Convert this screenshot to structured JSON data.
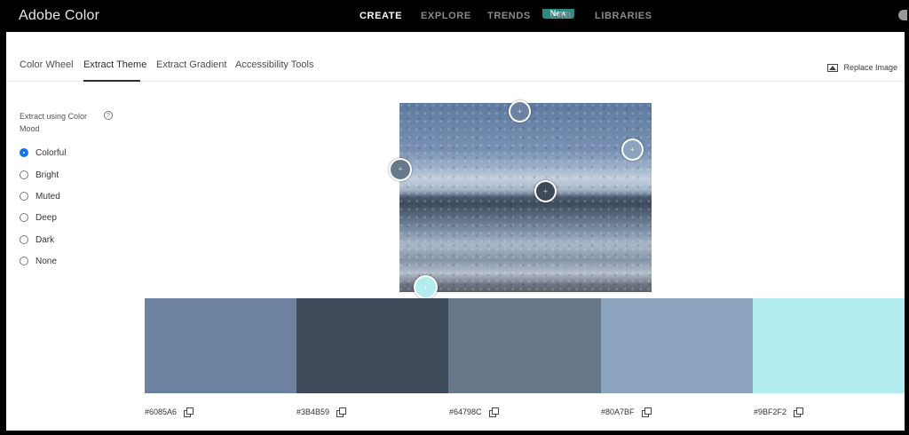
{
  "app": {
    "title": "Adobe Color"
  },
  "nav": {
    "items": [
      {
        "label": "CREATE"
      },
      {
        "label": "EXPLORE"
      },
      {
        "label": "TRENDS"
      },
      {
        "label": "LAB"
      },
      {
        "label": "LIBRARIES"
      }
    ],
    "active": "CREATE",
    "badge": "New"
  },
  "tabs": {
    "items": [
      {
        "label": "Color Wheel"
      },
      {
        "label": "Extract Theme"
      },
      {
        "label": "Extract Gradient"
      },
      {
        "label": "Accessibility Tools"
      }
    ],
    "active": "Extract Theme",
    "replace_label": "Replace Image"
  },
  "sidebar": {
    "mood_label": "Extract using Color Mood",
    "help": "?",
    "options": [
      {
        "label": "Colorful",
        "checked": true
      },
      {
        "label": "Bright",
        "checked": false
      },
      {
        "label": "Muted",
        "checked": false
      },
      {
        "label": "Deep",
        "checked": false
      },
      {
        "label": "Dark",
        "checked": false
      },
      {
        "label": "None",
        "checked": false
      }
    ]
  },
  "swatches": [
    {
      "hex": "#6085A6",
      "color": "#6d82a0"
    },
    {
      "hex": "#3B4B59",
      "color": "#3e4a59"
    },
    {
      "hex": "#64798C",
      "color": "#67788a"
    },
    {
      "hex": "#80A7BF",
      "color": "#8ca4bd"
    },
    {
      "hex": "#9BF2F2",
      "color": "#b2ecef"
    }
  ],
  "icons": {
    "replace": "image-icon",
    "copy": "copy-icon",
    "help": "help-icon",
    "sampler": "plus-icon"
  }
}
